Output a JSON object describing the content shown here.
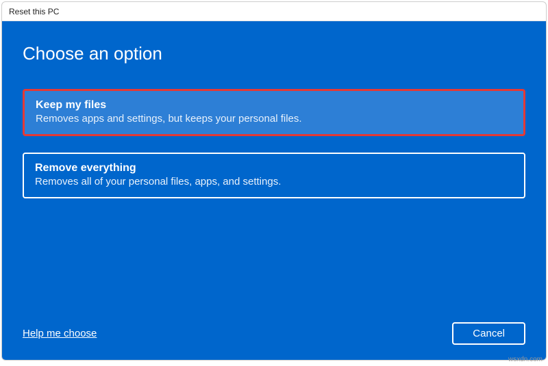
{
  "window": {
    "title": "Reset this PC"
  },
  "page": {
    "heading": "Choose an option"
  },
  "options": {
    "keep": {
      "title": "Keep my files",
      "desc": "Removes apps and settings, but keeps your personal files."
    },
    "remove": {
      "title": "Remove everything",
      "desc": "Removes all of your personal files, apps, and settings."
    }
  },
  "footer": {
    "help_link": "Help me choose",
    "cancel_label": "Cancel"
  },
  "watermark": "wsxdn.com"
}
